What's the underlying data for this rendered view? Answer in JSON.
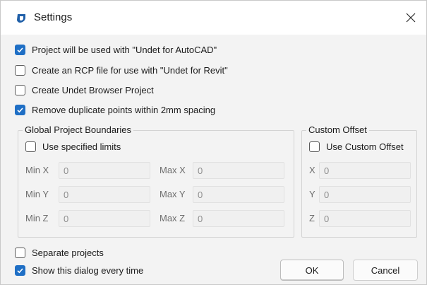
{
  "window": {
    "title": "Settings",
    "accent_color": "#1f6fc5"
  },
  "options": [
    {
      "label": "Project will be used with \"Undet for AutoCAD\"",
      "checked": true
    },
    {
      "label": "Create an RCP file for use with \"Undet for Revit\"",
      "checked": false
    },
    {
      "label": "Create Undet Browser Project",
      "checked": false
    },
    {
      "label": "Remove duplicate points within 2mm spacing",
      "checked": true
    }
  ],
  "boundaries": {
    "title": "Global Project Boundaries",
    "use_limits_label": "Use specified limits",
    "use_limits_checked": false,
    "min_x_label": "Min X",
    "min_x_value": "0",
    "min_y_label": "Min Y",
    "min_y_value": "0",
    "min_z_label": "Min Z",
    "min_z_value": "0",
    "max_x_label": "Max X",
    "max_x_value": "0",
    "max_y_label": "Max Y",
    "max_y_value": "0",
    "max_z_label": "Max Z",
    "max_z_value": "0"
  },
  "offset": {
    "title": "Custom Offset",
    "use_offset_label": "Use Custom Offset",
    "use_offset_checked": false,
    "x_label": "X",
    "x_value": "0",
    "y_label": "Y",
    "y_value": "0",
    "z_label": "Z",
    "z_value": "0"
  },
  "bottom": {
    "separate_label": "Separate projects",
    "separate_checked": false,
    "show_dialog_label": "Show this dialog every time",
    "show_dialog_checked": true
  },
  "buttons": {
    "ok_label": "OK",
    "cancel_label": "Cancel"
  }
}
